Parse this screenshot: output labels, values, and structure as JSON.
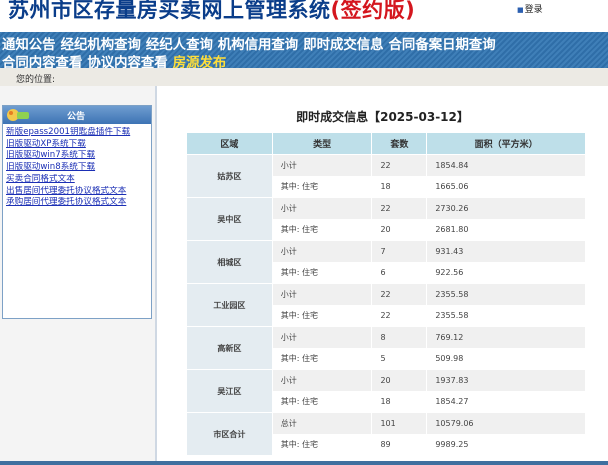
{
  "header": {
    "title": "苏州市区存量房买卖网上管理系统",
    "edition": "(签约版)",
    "login_label": "登录"
  },
  "nav": {
    "row1": [
      "通知公告",
      "经纪机构查询",
      "经纪人查询",
      "机构信用查询",
      "即时成交信息",
      "合同备案日期查询"
    ],
    "row2": [
      "合同内容查看",
      "协议内容查看"
    ],
    "highlight": "房源发布"
  },
  "location": {
    "label": "您的位置:"
  },
  "notice": {
    "title": "公告",
    "items": [
      "新版epass2001钥匙盘插件下载",
      "旧版驱动XP系统下载",
      "旧版驱动win7系统下载",
      "旧版驱动win8系统下载",
      "买卖合同格式文本",
      "出售居间代理委托协议格式文本",
      "承购居间代理委托协议格式文本"
    ]
  },
  "deals": {
    "title": "即时成交信息【2025-03-12】",
    "headers": [
      "区域",
      "类型",
      "套数",
      "面积（平方米）"
    ],
    "rows": [
      {
        "district": "姑苏区",
        "items": [
          [
            "小计",
            "22",
            "1854.84"
          ],
          [
            "其中: 住宅",
            "18",
            "1665.06"
          ]
        ]
      },
      {
        "district": "吴中区",
        "items": [
          [
            "小计",
            "22",
            "2730.26"
          ],
          [
            "其中: 住宅",
            "20",
            "2681.80"
          ]
        ]
      },
      {
        "district": "相城区",
        "items": [
          [
            "小计",
            "7",
            "931.43"
          ],
          [
            "其中: 住宅",
            "6",
            "922.56"
          ]
        ]
      },
      {
        "district": "工业园区",
        "items": [
          [
            "小计",
            "22",
            "2355.58"
          ],
          [
            "其中: 住宅",
            "22",
            "2355.58"
          ]
        ]
      },
      {
        "district": "高新区",
        "items": [
          [
            "小计",
            "8",
            "769.12"
          ],
          [
            "其中: 住宅",
            "5",
            "509.98"
          ]
        ]
      },
      {
        "district": "吴江区",
        "items": [
          [
            "小计",
            "20",
            "1937.83"
          ],
          [
            "其中: 住宅",
            "18",
            "1854.27"
          ]
        ]
      },
      {
        "district": "市区合计",
        "items": [
          [
            "总计",
            "101",
            "10579.06"
          ],
          [
            "其中: 住宅",
            "89",
            "9989.25"
          ]
        ]
      }
    ]
  },
  "colors": {
    "title_blue": "#0a3d8a",
    "edition_red": "#d4161e",
    "nav_blue": "#2f6ea8",
    "nav_highlight": "#ffde3a",
    "table_header": "#bedfe9"
  }
}
